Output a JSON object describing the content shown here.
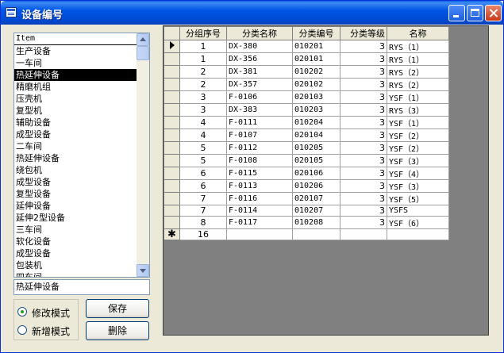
{
  "window": {
    "title": "设备编号"
  },
  "list": {
    "header": "Item",
    "items": [
      "生产设备",
      "一车间",
      "热延伸设备",
      "精磨机组",
      "压壳机",
      "复型机",
      "辅助设备",
      "成型设备",
      "二车间",
      "热延伸设备",
      "绕包机",
      "成型设备",
      "复型设备",
      "延伸设备",
      "延伸2型设备",
      "三车间",
      "软化设备",
      "成型设备",
      "包装机",
      "四车间"
    ],
    "selected_index": 2
  },
  "textbox": {
    "value": "热延伸设备"
  },
  "modes": {
    "modify": "修改模式",
    "add": "新增模式",
    "checked": "modify"
  },
  "buttons": {
    "save": "保存",
    "delete": "删除"
  },
  "grid": {
    "columns": [
      "分组序号",
      "分类名称",
      "分类编号",
      "分类等级",
      "名称"
    ],
    "rows": [
      [
        "1",
        "DX-380",
        "010201",
        "3",
        "RYS（1）"
      ],
      [
        "1",
        "DX-356",
        "020101",
        "3",
        "RYS（1）"
      ],
      [
        "2",
        "DX-381",
        "010202",
        "3",
        "RYS（2）"
      ],
      [
        "2",
        "DX-357",
        "020102",
        "3",
        "RYS（2）"
      ],
      [
        "3",
        "F-0106",
        "020103",
        "3",
        "YSF（1）"
      ],
      [
        "3",
        "DX-383",
        "010203",
        "3",
        "RYS（3）"
      ],
      [
        "4",
        "F-0111",
        "010204",
        "3",
        "YSF（1）"
      ],
      [
        "4",
        "F-0107",
        "020104",
        "3",
        "YSF（2）"
      ],
      [
        "5",
        "F-0112",
        "010205",
        "3",
        "YSF（2）"
      ],
      [
        "5",
        "F-0108",
        "020105",
        "3",
        "YSF（3）"
      ],
      [
        "6",
        "F-0115",
        "020106",
        "3",
        "YSF（4）"
      ],
      [
        "6",
        "F-0113",
        "010206",
        "3",
        "YSF（3）"
      ],
      [
        "7",
        "F-0116",
        "020107",
        "3",
        "YSF（5）"
      ],
      [
        "7",
        "F-0114",
        "010207",
        "3",
        "YSFS"
      ],
      [
        "8",
        "F-0117",
        "010208",
        "3",
        "YSF（6）"
      ]
    ],
    "new_row": {
      "marker": "✱",
      "value": "16"
    },
    "current_marker": "▶"
  }
}
